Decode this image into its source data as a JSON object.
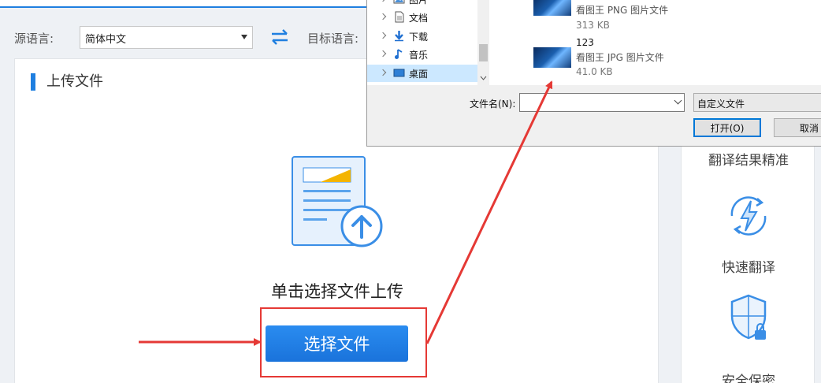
{
  "lang": {
    "source_label": "源语言:",
    "source_value": "简体中文",
    "target_label": "目标语言:"
  },
  "upload": {
    "title": "上传文件",
    "hint_prefix": "单击选择文件",
    "hint_suffix": "上传",
    "button": "选择文件"
  },
  "features": [
    {
      "label": "翻译结果精准",
      "icon": "target-icon"
    },
    {
      "label": "快速翻译",
      "icon": "lightning-icon"
    },
    {
      "label": "安全保密",
      "icon": "shield-lock-icon"
    }
  ],
  "dialog": {
    "nav": [
      {
        "label": "图片",
        "icon": "pictures-icon"
      },
      {
        "label": "文档",
        "icon": "documents-icon"
      },
      {
        "label": "下载",
        "icon": "downloads-icon"
      },
      {
        "label": "音乐",
        "icon": "music-icon"
      },
      {
        "label": "桌面",
        "icon": "desktop-icon"
      }
    ],
    "files": [
      {
        "name": "",
        "type": "看图王 PNG 图片文件",
        "size": "313 KB"
      },
      {
        "name": "123",
        "type": "看图王 JPG 图片文件",
        "size": "41.0 KB"
      }
    ],
    "filename_label": "文件名(N):",
    "filetype_value": "自定义文件",
    "open_button": "打开(O)",
    "cancel_button": "取消"
  },
  "colors": {
    "accent": "#1f7fe0",
    "annotation_red": "#e53935"
  }
}
